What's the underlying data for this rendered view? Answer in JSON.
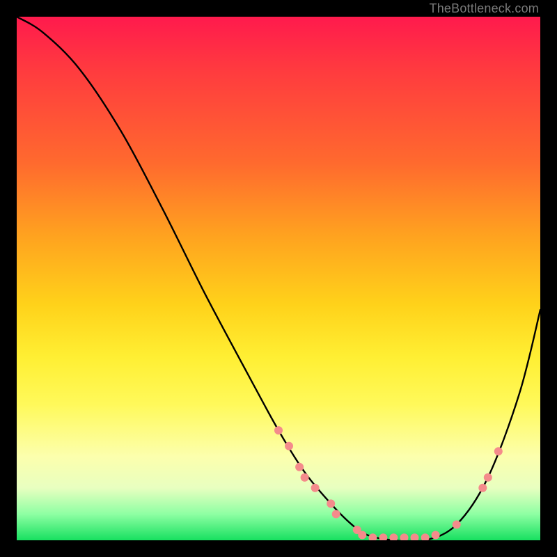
{
  "attribution": "TheBottleneck.com",
  "chart_data": {
    "type": "line",
    "title": "",
    "xlabel": "",
    "ylabel": "",
    "xlim": [
      0,
      100
    ],
    "ylim": [
      0,
      100
    ],
    "background_gradient": {
      "direction": "vertical",
      "stops": [
        {
          "pos": 0,
          "color": "#ff1a4d"
        },
        {
          "pos": 10,
          "color": "#ff3a3f"
        },
        {
          "pos": 28,
          "color": "#ff6a2e"
        },
        {
          "pos": 42,
          "color": "#ffa31f"
        },
        {
          "pos": 55,
          "color": "#ffd21a"
        },
        {
          "pos": 65,
          "color": "#ffef33"
        },
        {
          "pos": 74,
          "color": "#fff95a"
        },
        {
          "pos": 84,
          "color": "#fcffad"
        },
        {
          "pos": 90,
          "color": "#e8ffc0"
        },
        {
          "pos": 95,
          "color": "#8effa3"
        },
        {
          "pos": 100,
          "color": "#17e060"
        }
      ]
    },
    "series": [
      {
        "name": "bottleneck-curve",
        "color": "#000000",
        "x": [
          0,
          5,
          12,
          20,
          28,
          36,
          44,
          50,
          55,
          60,
          64,
          67,
          72,
          78,
          84,
          90,
          96,
          100
        ],
        "y": [
          100,
          97,
          90,
          78,
          63,
          47,
          32,
          21,
          13,
          7,
          3,
          1,
          0,
          0,
          3,
          12,
          28,
          44
        ]
      }
    ],
    "markers": {
      "name": "highlight-points",
      "color": "#f48b8b",
      "radius": 6,
      "points": [
        {
          "x": 50,
          "y": 21
        },
        {
          "x": 52,
          "y": 18
        },
        {
          "x": 54,
          "y": 14
        },
        {
          "x": 55,
          "y": 12
        },
        {
          "x": 57,
          "y": 10
        },
        {
          "x": 60,
          "y": 7
        },
        {
          "x": 61,
          "y": 5
        },
        {
          "x": 65,
          "y": 2
        },
        {
          "x": 66,
          "y": 1
        },
        {
          "x": 68,
          "y": 0.5
        },
        {
          "x": 70,
          "y": 0.5
        },
        {
          "x": 72,
          "y": 0.5
        },
        {
          "x": 74,
          "y": 0.5
        },
        {
          "x": 76,
          "y": 0.5
        },
        {
          "x": 78,
          "y": 0.5
        },
        {
          "x": 80,
          "y": 1
        },
        {
          "x": 84,
          "y": 3
        },
        {
          "x": 89,
          "y": 10
        },
        {
          "x": 90,
          "y": 12
        },
        {
          "x": 92,
          "y": 17
        }
      ]
    }
  }
}
